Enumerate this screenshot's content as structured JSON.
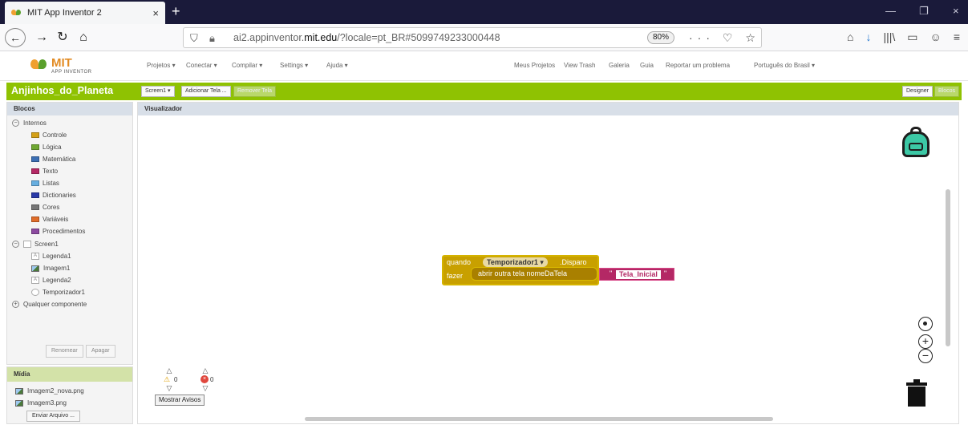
{
  "browser": {
    "tab_title": "MIT App Inventor 2",
    "tab_close": "×",
    "new_tab": "+",
    "url_prefix": "ai2.appinventor.",
    "url_domain": "mit.edu",
    "url_suffix": "/?locale=pt_BR#5099749233000448",
    "zoom": "80%",
    "url_actions": "··· ♡ ☆",
    "window_controls": [
      "—",
      "❐",
      "×"
    ],
    "toolbar_icons": [
      "⌂",
      "↓",
      "|||\\",
      "▭",
      "☺",
      "≡"
    ]
  },
  "appbar": {
    "logo_text": "MIT",
    "logo_sub": "APP INVENTOR",
    "menus": [
      "Projetos ▾",
      "Conectar ▾",
      "Compilar ▾",
      "Settings ▾",
      "Ajuda ▾"
    ],
    "right_links": [
      "Meus Projetos",
      "View Trash",
      "Galeria",
      "Guia",
      "Reportar um problema",
      "Português do Brasil ▾"
    ]
  },
  "project": {
    "name": "Anjinhos_do_Planeta",
    "screen_select": "Screen1 ▾",
    "add_screen": "Adicionar Tela ...",
    "remove_screen": "Remover Tela",
    "designer": "Designer",
    "blocks": "Blocos"
  },
  "blocks_panel": {
    "title": "Blocos",
    "builtin_label": "Internos",
    "builtin": [
      {
        "label": "Controle",
        "color": "#d4a017"
      },
      {
        "label": "Lógica",
        "color": "#6fa832"
      },
      {
        "label": "Matemática",
        "color": "#3c6fb4"
      },
      {
        "label": "Texto",
        "color": "#b42865"
      },
      {
        "label": "Listas",
        "color": "#66aee0"
      },
      {
        "label": "Dictionaries",
        "color": "#2a3aa8"
      },
      {
        "label": "Cores",
        "color": "#777777"
      },
      {
        "label": "Variáveis",
        "color": "#e06d2a"
      },
      {
        "label": "Procedimentos",
        "color": "#8c4aa0"
      }
    ],
    "screen_label": "Screen1",
    "components": [
      "Legenda1",
      "Imagem1",
      "Legenda2",
      "Temporizador1"
    ],
    "any_component": "Qualquer componente",
    "rename": "Renomear",
    "delete": "Apagar"
  },
  "media": {
    "title": "Mídia",
    "files": [
      "Imagem2_nova.png",
      "Imagem3.png"
    ],
    "upload": "Enviar Arquivo ..."
  },
  "viewer": {
    "title": "Visualizador",
    "block": {
      "when": "quando",
      "component": "Temporizador1",
      "event": ".Disparo",
      "do": "fazer",
      "procedure": "abrir outra tela  nomeDaTela",
      "text_value": "Tela_Inicial"
    },
    "warnings_count": "0",
    "errors_count": "0",
    "show_warnings": "Mostrar Avisos"
  }
}
